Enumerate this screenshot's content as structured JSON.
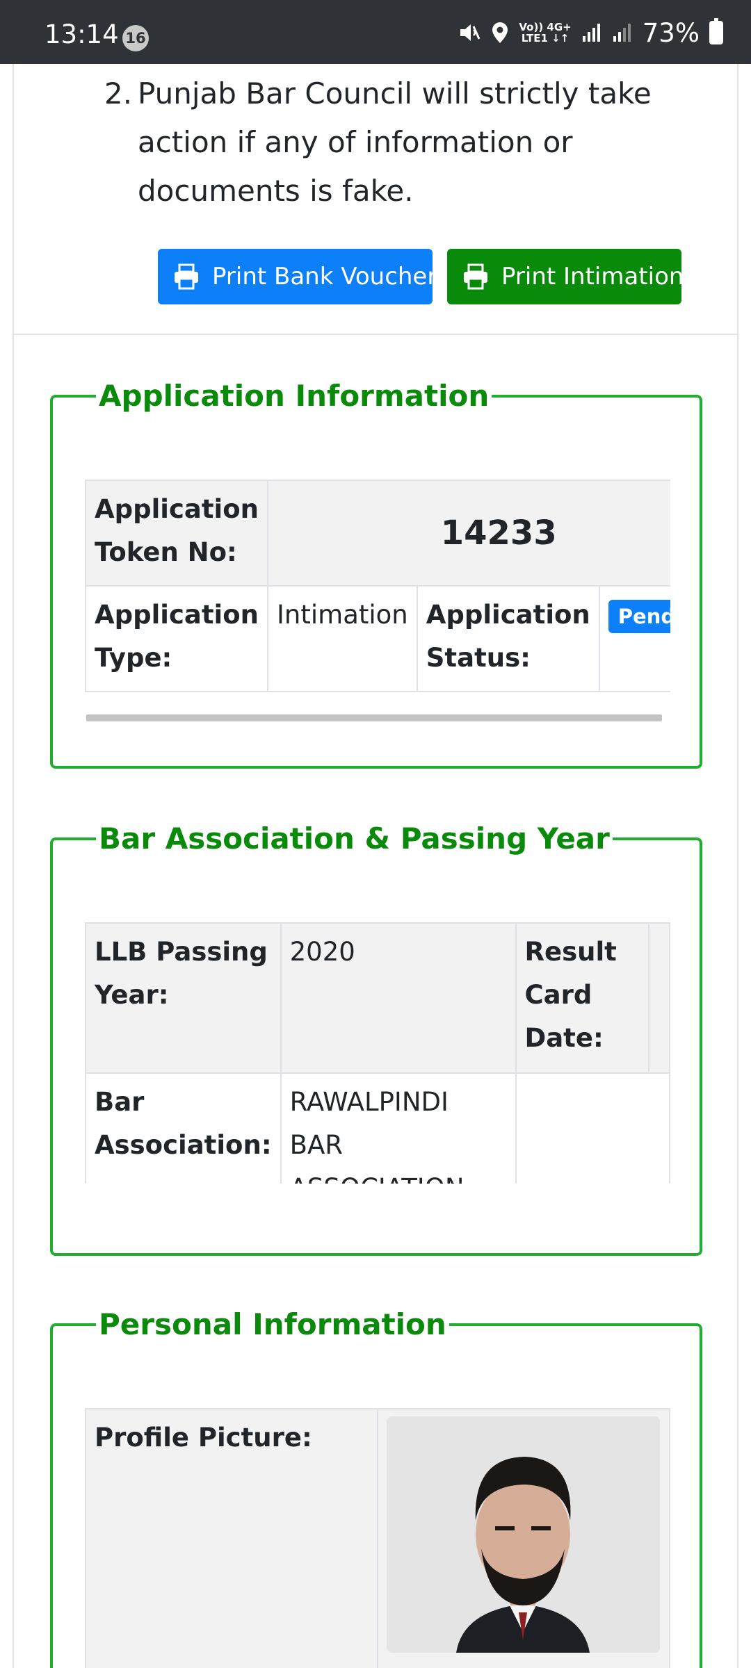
{
  "status_bar": {
    "time": "13:14",
    "notification_count": "16",
    "network_top": "Vo)) 4G+",
    "network_bottom": "LTE1 ↓↑",
    "battery": "73%"
  },
  "notice": {
    "number": "2.",
    "text": "Punjab Bar Council will strictly take action if any of information or documents is fake."
  },
  "buttons": {
    "print_voucher": "Print Bank Voucher",
    "print_intimation": "Print Intimation"
  },
  "colors": {
    "primary": "#0d7ff9",
    "success": "#0a8a0a",
    "fieldset_border": "#1fae30"
  },
  "application_info": {
    "legend": "Application Information",
    "token_label": "Application Token No:",
    "token_value": "14233",
    "type_label": "Application Type:",
    "type_value": "Intimation",
    "status_label": "Application Status:",
    "status_value": "Pending"
  },
  "bar_association": {
    "legend": "Bar Association & Passing Year",
    "passing_year_label": "LLB Passing Year:",
    "passing_year_value": "2020",
    "result_card_label": "Result Card Date:",
    "association_label": "Bar Association:",
    "association_value": "RAWALPINDI BAR ASSOCIATION"
  },
  "personal_info": {
    "legend": "Personal Information",
    "profile_picture_label": "Profile Picture:"
  }
}
